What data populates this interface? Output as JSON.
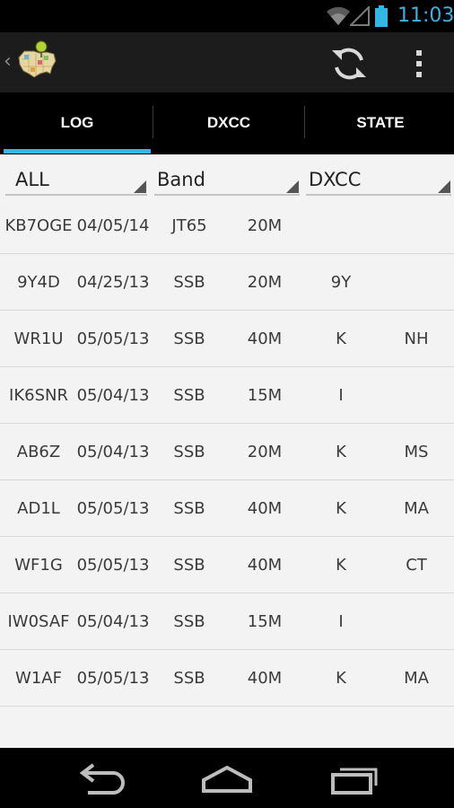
{
  "status_bar": {
    "time": "11:03",
    "icons": [
      "wifi-icon",
      "signal-icon",
      "battery-icon"
    ],
    "accent_color": "#33b5e5"
  },
  "action_bar": {
    "icons": [
      "back-caret-icon",
      "usa-map-logo-icon",
      "refresh-icon",
      "overflow-menu-icon"
    ]
  },
  "tabs": [
    {
      "label": "LOG",
      "selected": true
    },
    {
      "label": "DXCC",
      "selected": false
    },
    {
      "label": "STATE",
      "selected": false
    }
  ],
  "filters": {
    "filter1": "ALL",
    "filter2": "Band",
    "filter3": "DXCC"
  },
  "log": [
    {
      "call": "KB7OGE",
      "date": "04/05/14",
      "mode": "JT65",
      "band": "20M",
      "dxcc": "",
      "state": ""
    },
    {
      "call": "9Y4D",
      "date": "04/25/13",
      "mode": "SSB",
      "band": "20M",
      "dxcc": "9Y",
      "state": ""
    },
    {
      "call": "WR1U",
      "date": "05/05/13",
      "mode": "SSB",
      "band": "40M",
      "dxcc": "K",
      "state": "NH"
    },
    {
      "call": "IK6SNR",
      "date": "05/04/13",
      "mode": "SSB",
      "band": "15M",
      "dxcc": "I",
      "state": ""
    },
    {
      "call": "AB6Z",
      "date": "05/04/13",
      "mode": "SSB",
      "band": "20M",
      "dxcc": "K",
      "state": "MS"
    },
    {
      "call": "AD1L",
      "date": "05/05/13",
      "mode": "SSB",
      "band": "40M",
      "dxcc": "K",
      "state": "MA"
    },
    {
      "call": "WF1G",
      "date": "05/05/13",
      "mode": "SSB",
      "band": "40M",
      "dxcc": "K",
      "state": "CT"
    },
    {
      "call": "IW0SAF",
      "date": "05/04/13",
      "mode": "SSB",
      "band": "15M",
      "dxcc": "I",
      "state": ""
    },
    {
      "call": "W1AF",
      "date": "05/05/13",
      "mode": "SSB",
      "band": "40M",
      "dxcc": "K",
      "state": "MA"
    }
  ],
  "nav_bar": {
    "icons": [
      "back-icon",
      "home-icon",
      "recent-apps-icon"
    ]
  }
}
